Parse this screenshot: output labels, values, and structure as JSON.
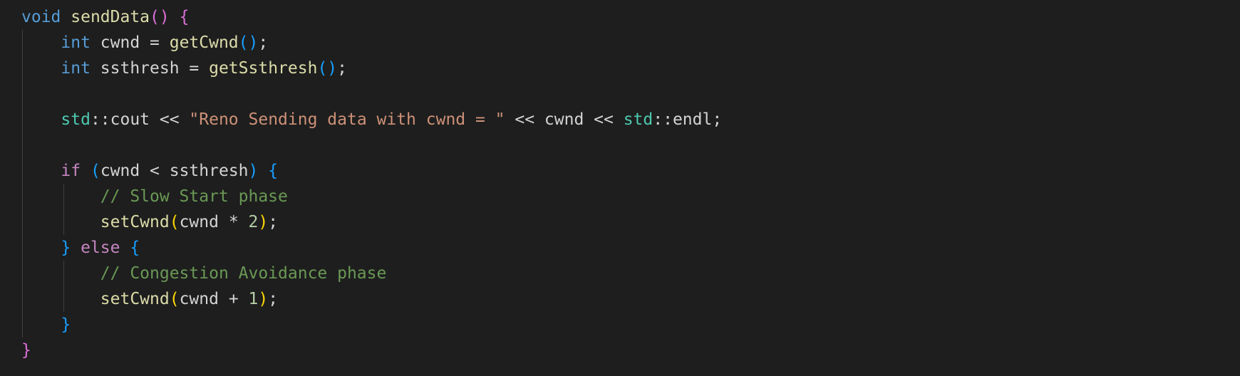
{
  "editor": {
    "theme": {
      "background": "#1e1e1e",
      "default_text": "#d4d4d4",
      "storage_type": "#569cd6",
      "control_keyword": "#c586c0",
      "function": "#dcdcaa",
      "namespace": "#4ec9b0",
      "string": "#ce9178",
      "number": "#b5cea8",
      "comment": "#6a9955",
      "bracket_level_1": "#da70d6",
      "bracket_level_2": "#179fff",
      "bracket_level_3": "#ffd700",
      "indent_guide": "#404040"
    },
    "lines": [
      {
        "tokens": [
          {
            "t": "void",
            "c": "kw-storage"
          },
          {
            "t": " ",
            "c": "var"
          },
          {
            "t": "sendData",
            "c": "fn"
          },
          {
            "t": "()",
            "c": "p1"
          },
          {
            "t": " ",
            "c": "var"
          },
          {
            "t": "{",
            "c": "p1"
          }
        ]
      },
      {
        "tokens": [
          {
            "t": "    ",
            "c": "var"
          },
          {
            "t": "int",
            "c": "kw-storage"
          },
          {
            "t": " cwnd = ",
            "c": "var"
          },
          {
            "t": "getCwnd",
            "c": "fn"
          },
          {
            "t": "()",
            "c": "p2"
          },
          {
            "t": ";",
            "c": "var"
          }
        ]
      },
      {
        "tokens": [
          {
            "t": "    ",
            "c": "var"
          },
          {
            "t": "int",
            "c": "kw-storage"
          },
          {
            "t": " ssthresh = ",
            "c": "var"
          },
          {
            "t": "getSsthresh",
            "c": "fn"
          },
          {
            "t": "()",
            "c": "p2"
          },
          {
            "t": ";",
            "c": "var"
          }
        ]
      },
      {
        "tokens": []
      },
      {
        "tokens": [
          {
            "t": "    ",
            "c": "var"
          },
          {
            "t": "std",
            "c": "ns"
          },
          {
            "t": "::cout << ",
            "c": "var"
          },
          {
            "t": "\"Reno Sending data with cwnd = \"",
            "c": "str"
          },
          {
            "t": " << cwnd << ",
            "c": "var"
          },
          {
            "t": "std",
            "c": "ns"
          },
          {
            "t": "::endl;",
            "c": "var"
          }
        ]
      },
      {
        "tokens": []
      },
      {
        "tokens": [
          {
            "t": "    ",
            "c": "var"
          },
          {
            "t": "if",
            "c": "kw-control"
          },
          {
            "t": " ",
            "c": "var"
          },
          {
            "t": "(",
            "c": "p2"
          },
          {
            "t": "cwnd < ssthresh",
            "c": "var"
          },
          {
            "t": ")",
            "c": "p2"
          },
          {
            "t": " ",
            "c": "var"
          },
          {
            "t": "{",
            "c": "p2"
          }
        ]
      },
      {
        "tokens": [
          {
            "t": "        ",
            "c": "var"
          },
          {
            "t": "// Slow Start phase",
            "c": "cmt"
          }
        ]
      },
      {
        "tokens": [
          {
            "t": "        ",
            "c": "var"
          },
          {
            "t": "setCwnd",
            "c": "fn"
          },
          {
            "t": "(",
            "c": "p3"
          },
          {
            "t": "cwnd * ",
            "c": "var"
          },
          {
            "t": "2",
            "c": "num"
          },
          {
            "t": ")",
            "c": "p3"
          },
          {
            "t": ";",
            "c": "var"
          }
        ]
      },
      {
        "tokens": [
          {
            "t": "    ",
            "c": "var"
          },
          {
            "t": "}",
            "c": "p2"
          },
          {
            "t": " ",
            "c": "var"
          },
          {
            "t": "else",
            "c": "kw-control"
          },
          {
            "t": " ",
            "c": "var"
          },
          {
            "t": "{",
            "c": "p2"
          }
        ]
      },
      {
        "tokens": [
          {
            "t": "        ",
            "c": "var"
          },
          {
            "t": "// Congestion Avoidance phase",
            "c": "cmt"
          }
        ]
      },
      {
        "tokens": [
          {
            "t": "        ",
            "c": "var"
          },
          {
            "t": "setCwnd",
            "c": "fn"
          },
          {
            "t": "(",
            "c": "p3"
          },
          {
            "t": "cwnd + ",
            "c": "var"
          },
          {
            "t": "1",
            "c": "num"
          },
          {
            "t": ")",
            "c": "p3"
          },
          {
            "t": ";",
            "c": "var"
          }
        ]
      },
      {
        "tokens": [
          {
            "t": "    ",
            "c": "var"
          },
          {
            "t": "}",
            "c": "p2"
          }
        ]
      },
      {
        "tokens": [
          {
            "t": "}",
            "c": "p1"
          }
        ]
      }
    ]
  }
}
